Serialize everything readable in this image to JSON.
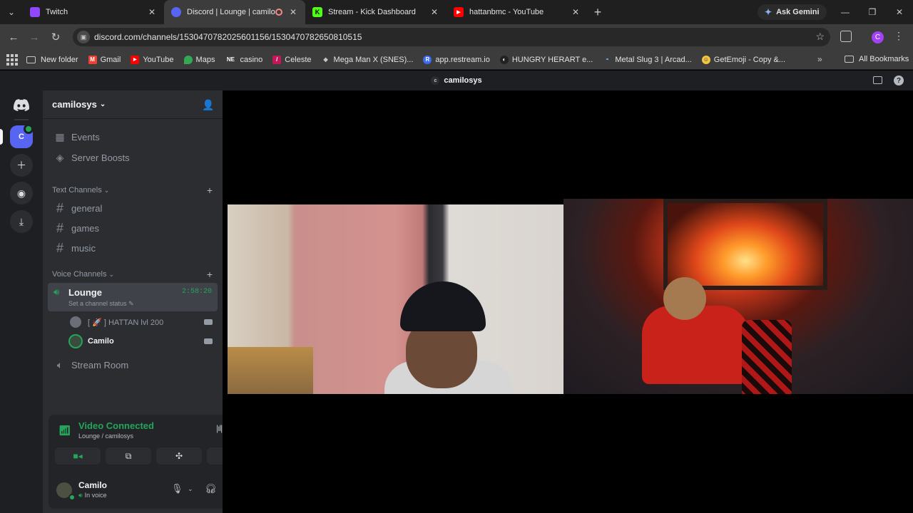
{
  "browser": {
    "tabs": [
      {
        "title": "Twitch",
        "color": "#9146ff",
        "glyph": "t"
      },
      {
        "title": "Discord | Lounge | camilosy",
        "color": "#5865f2",
        "glyph": "d"
      },
      {
        "title": "Stream - Kick Dashboard",
        "color": "#53fc18",
        "glyph": "K"
      },
      {
        "title": "hattanbmc - YouTube",
        "color": "#ff0000",
        "glyph": "▶"
      }
    ],
    "gemini_label": "Ask Gemini",
    "url": "discord.com/channels/1530470782025601156/1530470782650810515",
    "profile_initial": "C",
    "bookmarks": [
      {
        "label": "New folder",
        "color": "#c7c7c7",
        "glyph": ""
      },
      {
        "label": "Gmail",
        "color": "#ea4335",
        "glyph": "M"
      },
      {
        "label": "YouTube",
        "color": "#ff0000",
        "glyph": "▶"
      },
      {
        "label": "Maps",
        "color": "#34a853",
        "glyph": "●"
      },
      {
        "label": "casino",
        "color": "#3c3c3c",
        "glyph": "NE"
      },
      {
        "label": "Celeste",
        "color": "#c2185b",
        "glyph": "/"
      },
      {
        "label": "Mega Man X (SNES)...",
        "color": "#3c3c3c",
        "glyph": "◆"
      },
      {
        "label": "app.restream.io",
        "color": "#3b6cf6",
        "glyph": "R"
      },
      {
        "label": "HUNGRY HERART e...",
        "color": "#222",
        "glyph": "◐"
      },
      {
        "label": "Metal Slug 3 | Arcad...",
        "color": "#3c3c3c",
        "glyph": "◓"
      },
      {
        "label": "GetEmoji - Copy &...",
        "color": "#f4c542",
        "glyph": "☺"
      }
    ],
    "all_bookmarks": "All Bookmarks"
  },
  "discord": {
    "window_title": "camilosys",
    "window_initial": "c",
    "server_initial": "C",
    "server_name": "camilosys",
    "top_items": [
      {
        "label": "Events",
        "icon": "calendar-icon"
      },
      {
        "label": "Server Boosts",
        "icon": "boost-icon"
      }
    ],
    "text_category": "Text Channels",
    "text_channels": [
      "general",
      "games",
      "music"
    ],
    "voice_category": "Voice Channels",
    "active_voice": {
      "name": "Lounge",
      "timer": "2:58:20",
      "status": "Set a channel status"
    },
    "voice_users": [
      {
        "name": "[ 🚀 ] HATTAN lvl 200"
      },
      {
        "name": "Camilo"
      }
    ],
    "other_voice": "Stream Room",
    "connection": {
      "title": "Video Connected",
      "subtitle": "Lounge / camilosys"
    },
    "user": {
      "name": "Camilo",
      "status": "In voice"
    }
  }
}
